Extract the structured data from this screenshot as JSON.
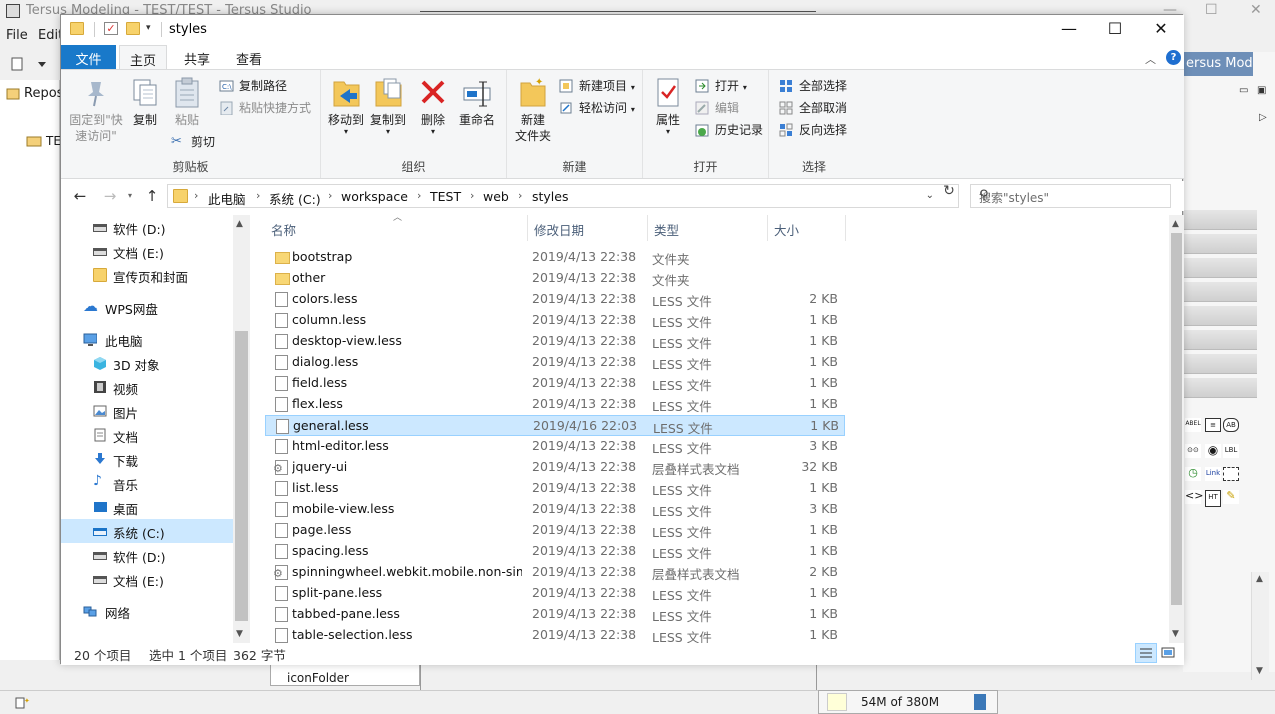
{
  "background_app": {
    "title": "Tersus Modeling - TEST/TEST - Tersus Studio",
    "menu": [
      "File",
      "Edit"
    ],
    "left_panel_header": "Repos",
    "left_panel_row": "TE",
    "right_tab": "ersus Mod...",
    "bottom_panel_item": "iconFolder",
    "memory": "54M of 380M",
    "palette": [
      "ABEL",
      "AB",
      "LBL",
      "Link",
      "HT"
    ]
  },
  "explorer": {
    "window_title": "styles",
    "ribbon_tabs": {
      "file": "文件",
      "home": "主页",
      "share": "共享",
      "view": "查看"
    },
    "ribbon": {
      "clipboard": {
        "label": "剪贴板",
        "pin": "固定到\"快\n速访问\"",
        "copy": "复制",
        "paste": "粘贴",
        "copy_path": "复制路径",
        "paste_shortcut": "粘贴快捷方式",
        "cut": "剪切"
      },
      "organize": {
        "label": "组织",
        "move_to": "移动到",
        "copy_to": "复制到",
        "delete": "删除",
        "rename": "重命名"
      },
      "new": {
        "label": "新建",
        "new_folder": "新建\n文件夹",
        "new_item": "新建项目",
        "easy_access": "轻松访问"
      },
      "open": {
        "label": "打开",
        "properties": "属性",
        "open": "打开",
        "edit": "编辑",
        "history": "历史记录"
      },
      "select": {
        "label": "选择",
        "select_all": "全部选择",
        "select_none": "全部取消",
        "invert": "反向选择"
      }
    },
    "address": {
      "crumbs": [
        "此电脑",
        "系统 (C:)",
        "workspace",
        "TEST",
        "web",
        "styles"
      ],
      "search_placeholder": "搜索\"styles\""
    },
    "nav": [
      {
        "label": "软件 (D:)",
        "icon": "drive-icon"
      },
      {
        "label": "文档 (E:)",
        "icon": "drive-icon"
      },
      {
        "label": "宣传页和封面",
        "icon": "folder-icon"
      },
      {
        "label": "WPS网盘",
        "icon": "cloud-icon"
      },
      {
        "label": "此电脑",
        "icon": "computer-icon"
      },
      {
        "label": "3D 对象",
        "icon": "cube-icon"
      },
      {
        "label": "视频",
        "icon": "video-icon"
      },
      {
        "label": "图片",
        "icon": "picture-icon"
      },
      {
        "label": "文档",
        "icon": "document-icon"
      },
      {
        "label": "下载",
        "icon": "download-icon"
      },
      {
        "label": "音乐",
        "icon": "music-icon"
      },
      {
        "label": "桌面",
        "icon": "desktop-icon"
      },
      {
        "label": "系统 (C:)",
        "icon": "system-drive-icon"
      },
      {
        "label": "软件 (D:)",
        "icon": "drive-icon"
      },
      {
        "label": "文档 (E:)",
        "icon": "drive-icon"
      },
      {
        "label": "网络",
        "icon": "network-icon"
      }
    ],
    "columns": {
      "name": "名称",
      "date": "修改日期",
      "type": "类型",
      "size": "大小"
    },
    "files": [
      {
        "name": "bootstrap",
        "date": "2019/4/13 22:38",
        "type": "文件夹",
        "size": "",
        "icon": "folder"
      },
      {
        "name": "other",
        "date": "2019/4/13 22:38",
        "type": "文件夹",
        "size": "",
        "icon": "folder"
      },
      {
        "name": "colors.less",
        "date": "2019/4/13 22:38",
        "type": "LESS 文件",
        "size": "2 KB",
        "icon": "file"
      },
      {
        "name": "column.less",
        "date": "2019/4/13 22:38",
        "type": "LESS 文件",
        "size": "1 KB",
        "icon": "file"
      },
      {
        "name": "desktop-view.less",
        "date": "2019/4/13 22:38",
        "type": "LESS 文件",
        "size": "1 KB",
        "icon": "file"
      },
      {
        "name": "dialog.less",
        "date": "2019/4/13 22:38",
        "type": "LESS 文件",
        "size": "1 KB",
        "icon": "file"
      },
      {
        "name": "field.less",
        "date": "2019/4/13 22:38",
        "type": "LESS 文件",
        "size": "1 KB",
        "icon": "file"
      },
      {
        "name": "flex.less",
        "date": "2019/4/13 22:38",
        "type": "LESS 文件",
        "size": "1 KB",
        "icon": "file"
      },
      {
        "name": "general.less",
        "date": "2019/4/16 22:03",
        "type": "LESS 文件",
        "size": "1 KB",
        "icon": "file"
      },
      {
        "name": "html-editor.less",
        "date": "2019/4/13 22:38",
        "type": "LESS 文件",
        "size": "3 KB",
        "icon": "file"
      },
      {
        "name": "jquery-ui",
        "date": "2019/4/13 22:38",
        "type": "层叠样式表文档",
        "size": "32 KB",
        "icon": "css"
      },
      {
        "name": "list.less",
        "date": "2019/4/13 22:38",
        "type": "LESS 文件",
        "size": "1 KB",
        "icon": "file"
      },
      {
        "name": "mobile-view.less",
        "date": "2019/4/13 22:38",
        "type": "LESS 文件",
        "size": "3 KB",
        "icon": "file"
      },
      {
        "name": "page.less",
        "date": "2019/4/13 22:38",
        "type": "LESS 文件",
        "size": "1 KB",
        "icon": "file"
      },
      {
        "name": "spacing.less",
        "date": "2019/4/13 22:38",
        "type": "LESS 文件",
        "size": "1 KB",
        "icon": "file"
      },
      {
        "name": "spinningwheel.webkit.mobile.non-sim...",
        "date": "2019/4/13 22:38",
        "type": "层叠样式表文档",
        "size": "2 KB",
        "icon": "css"
      },
      {
        "name": "split-pane.less",
        "date": "2019/4/13 22:38",
        "type": "LESS 文件",
        "size": "1 KB",
        "icon": "file"
      },
      {
        "name": "tabbed-pane.less",
        "date": "2019/4/13 22:38",
        "type": "LESS 文件",
        "size": "1 KB",
        "icon": "file"
      },
      {
        "name": "table-selection.less",
        "date": "2019/4/13 22:38",
        "type": "LESS 文件",
        "size": "1 KB",
        "icon": "file"
      }
    ],
    "selected_file": "general.less",
    "status": {
      "count": "20 个项目",
      "selected": "选中 1 个项目",
      "size": "362 字节"
    },
    "colors": {
      "accent": "#1979ca",
      "selection": "#cce8ff"
    }
  }
}
